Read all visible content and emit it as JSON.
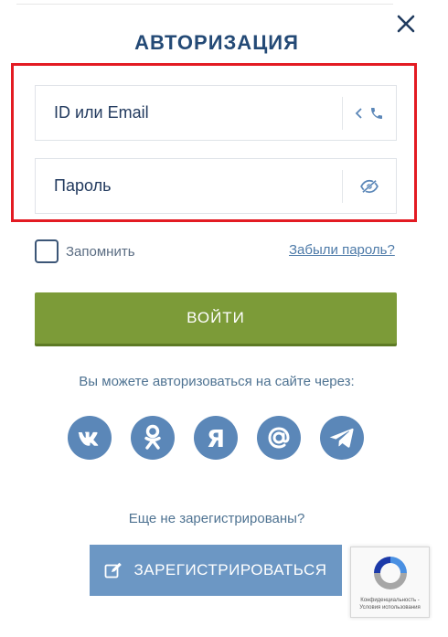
{
  "header": {
    "title": "АВТОРИЗАЦИЯ",
    "close_icon": "close-icon"
  },
  "form": {
    "id_field": {
      "placeholder": "ID или Email",
      "value": ""
    },
    "password_field": {
      "placeholder": "Пароль",
      "value": ""
    },
    "remember_label": "Запомнить",
    "remember_checked": false,
    "forgot_link": "Забыли пароль?",
    "login_button": "ВОЙТИ"
  },
  "social": {
    "prompt": "Вы можете авторизоваться на сайте через:",
    "providers": [
      "vk-icon",
      "odnoklassniki-icon",
      "yandex-icon",
      "email-at-icon",
      "telegram-icon"
    ]
  },
  "register": {
    "prompt": "Еще не зарегистрированы?",
    "button": "ЗАРЕГИСТРИРОВАТЬСЯ"
  },
  "recaptcha": {
    "text": "Конфиденциальность - Условия использования"
  },
  "colors": {
    "title": "#244a76",
    "highlight": "#e31b23",
    "login_button": "#7c9b38",
    "social_icon": "#5b87b8",
    "register_button": "#6c97c4"
  }
}
